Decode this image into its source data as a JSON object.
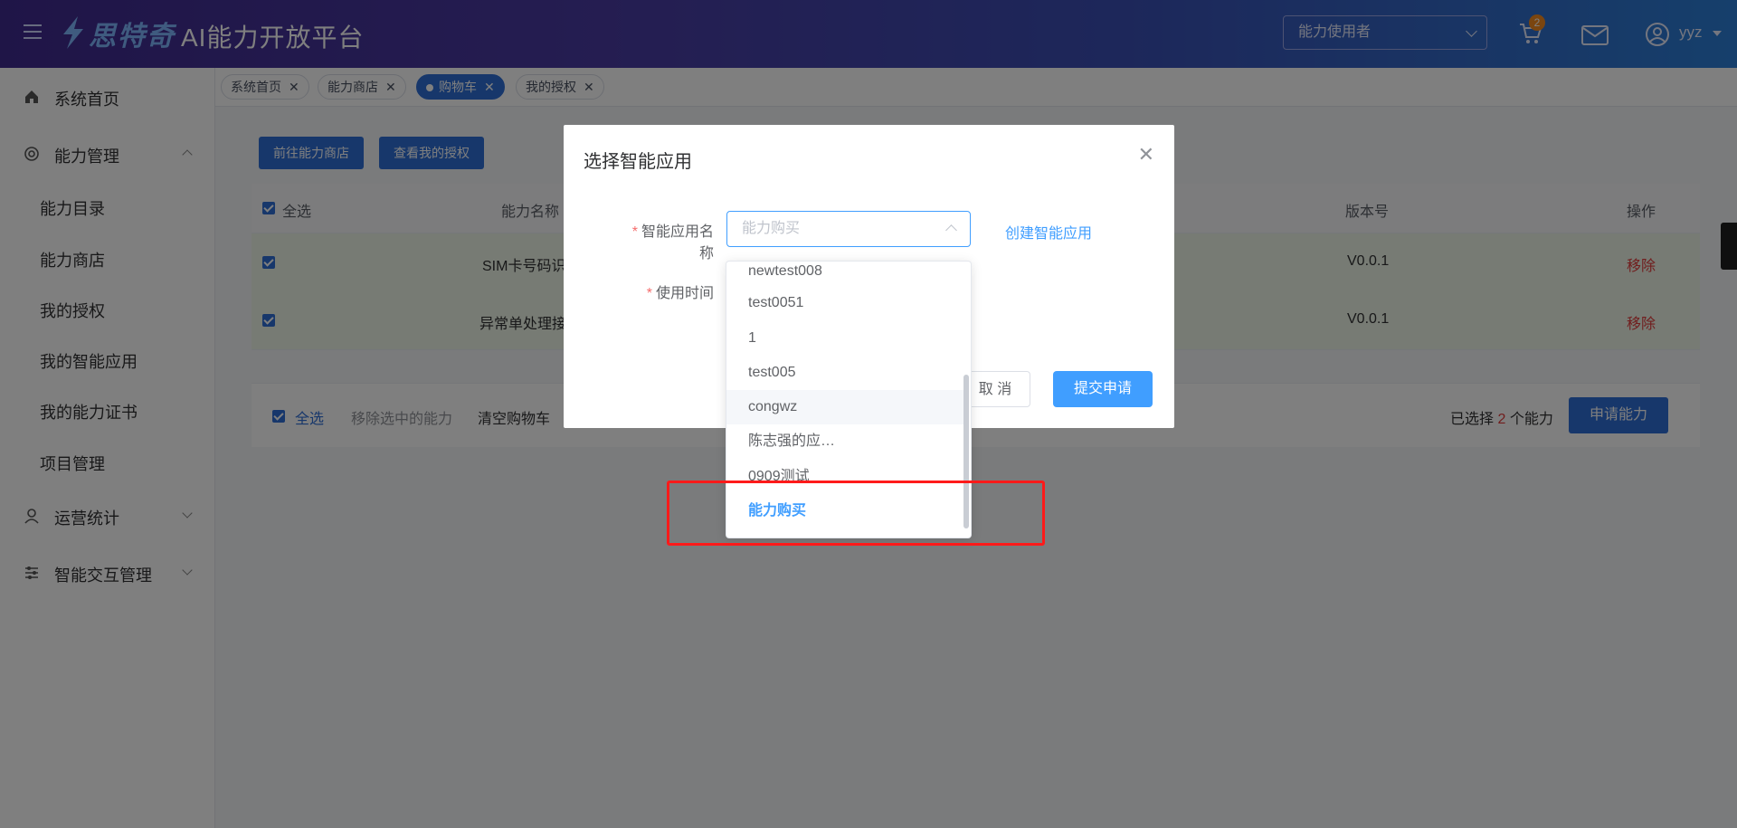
{
  "header": {
    "brand": "思特奇",
    "platform_title": "AI能力开放平台",
    "role_select": "能力使用者",
    "cart_badge": "2",
    "user": "yyz"
  },
  "sidebar": {
    "home": "系统首页",
    "ability_mgmt": "能力管理",
    "sub_items": [
      "能力目录",
      "能力商店",
      "我的授权",
      "我的智能应用",
      "我的能力证书",
      "项目管理"
    ],
    "ops_stats": "运营统计",
    "interaction_mgmt": "智能交互管理"
  },
  "tags": [
    {
      "label": "系统首页"
    },
    {
      "label": "能力商店"
    },
    {
      "label": "购物车"
    },
    {
      "label": "我的授权"
    }
  ],
  "main": {
    "btn_goto_store": "前往能力商店",
    "btn_view_auth": "查看我的授权",
    "table": {
      "select_all": "全选",
      "col_name": "能力名称",
      "col_version": "版本号",
      "col_action": "操作",
      "rows": [
        {
          "name": "SIM卡号码识",
          "version": "V0.0.1",
          "action": "移除"
        },
        {
          "name": "异常单处理接",
          "version": "V0.0.1",
          "action": "移除"
        }
      ]
    },
    "footer": {
      "select_all": "全选",
      "remove_selected": "移除选中的能力",
      "clear_cart": "清空购物车",
      "selected_prefix": "已选择",
      "selected_count": "2",
      "selected_suffix": "个能力",
      "apply_btn": "申请能力"
    }
  },
  "dialog": {
    "title": "选择智能应用",
    "label_app_name": "智能应用名称",
    "label_use_time": "使用时间",
    "select_placeholder": "能力购买",
    "create_link": "创建智能应用",
    "cancel": "取 消",
    "submit": "提交申请",
    "options": [
      "newtest008",
      "test0051",
      "1",
      "test005",
      "congwz",
      "陈志强的应…",
      "0909测试",
      "能力购买"
    ]
  },
  "colors": {
    "primary": "#409eff",
    "danger": "#e23b3b",
    "highlight_box": "#ff1a1a"
  }
}
